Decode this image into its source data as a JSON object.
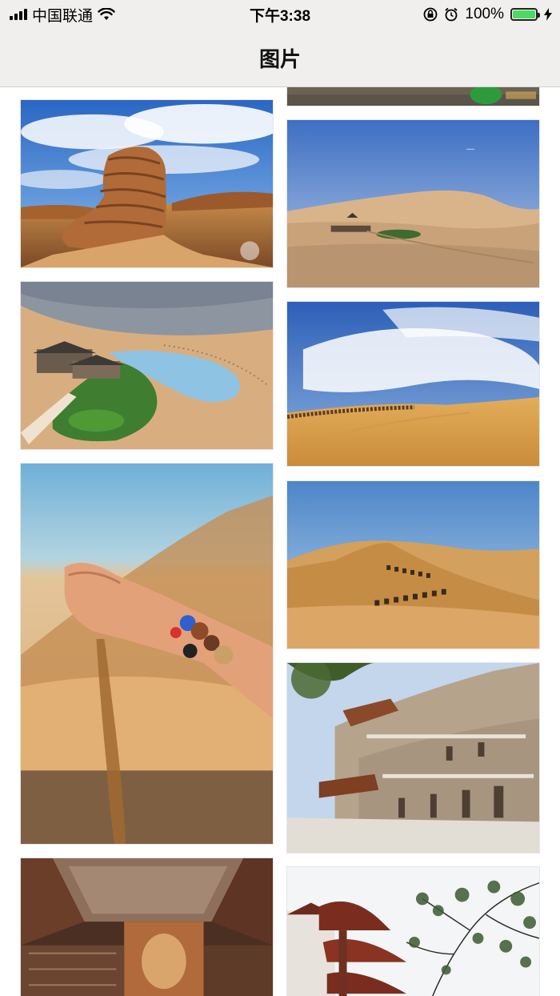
{
  "status_bar": {
    "carrier": "中国联通",
    "time": "下午3:38",
    "battery_text": "100%",
    "battery_level": 1.0,
    "icons": [
      "signal-icon",
      "wifi-icon",
      "rotation-lock-icon",
      "alarm-icon",
      "battery-icon",
      "charging-icon"
    ]
  },
  "nav": {
    "title": "图片"
  },
  "gallery": {
    "left_column": [
      {
        "name": "yadan-rock-photo",
        "subject": "rock"
      },
      {
        "name": "crescent-lake-photo",
        "subject": "lake"
      },
      {
        "name": "sand-hand-photo",
        "subject": "hand"
      },
      {
        "name": "cave-ceiling-photo",
        "subject": "cave"
      }
    ],
    "right_column": [
      {
        "name": "partial-photo-top",
        "subject": "partial"
      },
      {
        "name": "dunes-oasis-photo",
        "subject": "dunes"
      },
      {
        "name": "camel-caravan-sky-photo",
        "subject": "caravan"
      },
      {
        "name": "camel-dunes-photo",
        "subject": "camels"
      },
      {
        "name": "mogao-caves-photo",
        "subject": "mogao"
      },
      {
        "name": "pagoda-tree-photo",
        "subject": "pagoda"
      }
    ]
  }
}
